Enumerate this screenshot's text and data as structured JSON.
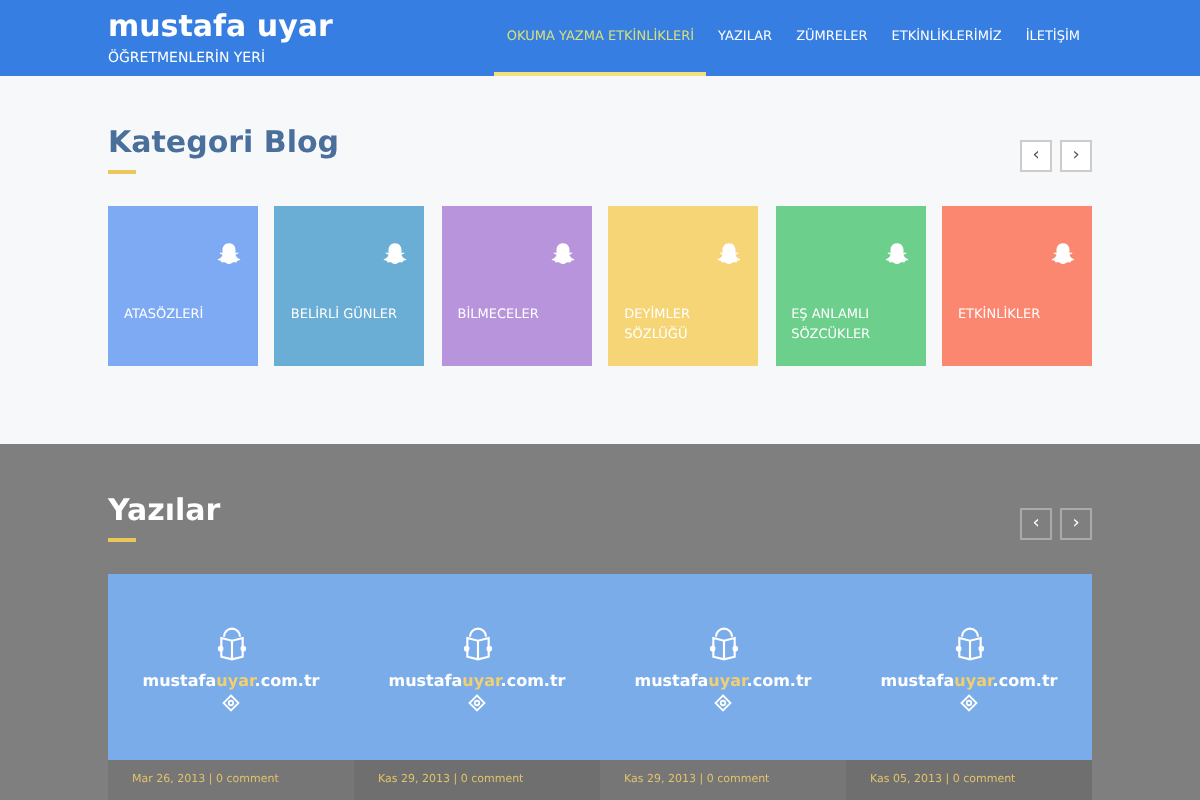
{
  "brand": {
    "title": "mustafa uyar",
    "subtitle": "ÖĞRETMENLERİN YERİ"
  },
  "nav": [
    {
      "label": "OKUMA YAZMA ETKİNLİKLERİ",
      "selected": true
    },
    {
      "label": "YAZILAR",
      "selected": false
    },
    {
      "label": "ZÜMRELER",
      "selected": false
    },
    {
      "label": "ETKİNLİKLERİMİZ",
      "selected": false
    },
    {
      "label": "İLETİŞİM",
      "selected": false
    }
  ],
  "categories": {
    "title": "Kategori Blog",
    "prev": "‹",
    "next": "›",
    "items": [
      {
        "label": "ATASÖZLERİ",
        "color": "#7eaaf4"
      },
      {
        "label": "BELİRLİ GÜNLER",
        "color": "#6aaed5"
      },
      {
        "label": "BİLMECELER",
        "color": "#b894dc"
      },
      {
        "label": "DEYİMLER SÖZLÜĞÜ",
        "color": "#f6d577"
      },
      {
        "label": "EŞ ANLAMLI SÖZCÜKLER",
        "color": "#6ccf8b"
      },
      {
        "label": "ETKİNLİKLER",
        "color": "#fc8770"
      }
    ]
  },
  "posts": {
    "title": "Yazılar",
    "prev": "‹",
    "next": "›",
    "items": [
      {
        "logo": [
          "mustafa",
          "uyar",
          ".com.tr"
        ],
        "meta": "Mar 26, 2013 | 0 comment"
      },
      {
        "logo": [
          "mustafa",
          "uyar",
          ".com.tr"
        ],
        "meta": "Kas 29, 2013 | 0 comment"
      },
      {
        "logo": [
          "mustafa",
          "uyar",
          ".com.tr"
        ],
        "meta": "Kas 29, 2013 | 0 comment"
      },
      {
        "logo": [
          "mustafa",
          "uyar",
          ".com.tr"
        ],
        "meta": "Kas 05, 2013 | 0 comment"
      }
    ]
  }
}
